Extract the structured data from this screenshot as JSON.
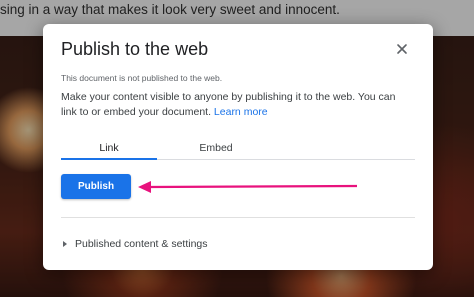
{
  "background": {
    "caption_text": "sing in a way that makes it look very sweet and innocent."
  },
  "dialog": {
    "title": "Publish to the web",
    "close_icon": "close-icon",
    "status": "This document is not published to the web.",
    "description": "Make your content visible to anyone by publishing it to the web. You can link to or embed your document.",
    "learn_more": "Learn more",
    "tabs": [
      {
        "label": "Link",
        "selected": true
      },
      {
        "label": "Embed",
        "selected": false
      }
    ],
    "publish_label": "Publish",
    "expander_label": "Published content & settings",
    "expander_icon": "triangle-right-icon"
  },
  "colors": {
    "accent": "#1a73e8",
    "annotation_arrow": "#e8127d"
  }
}
